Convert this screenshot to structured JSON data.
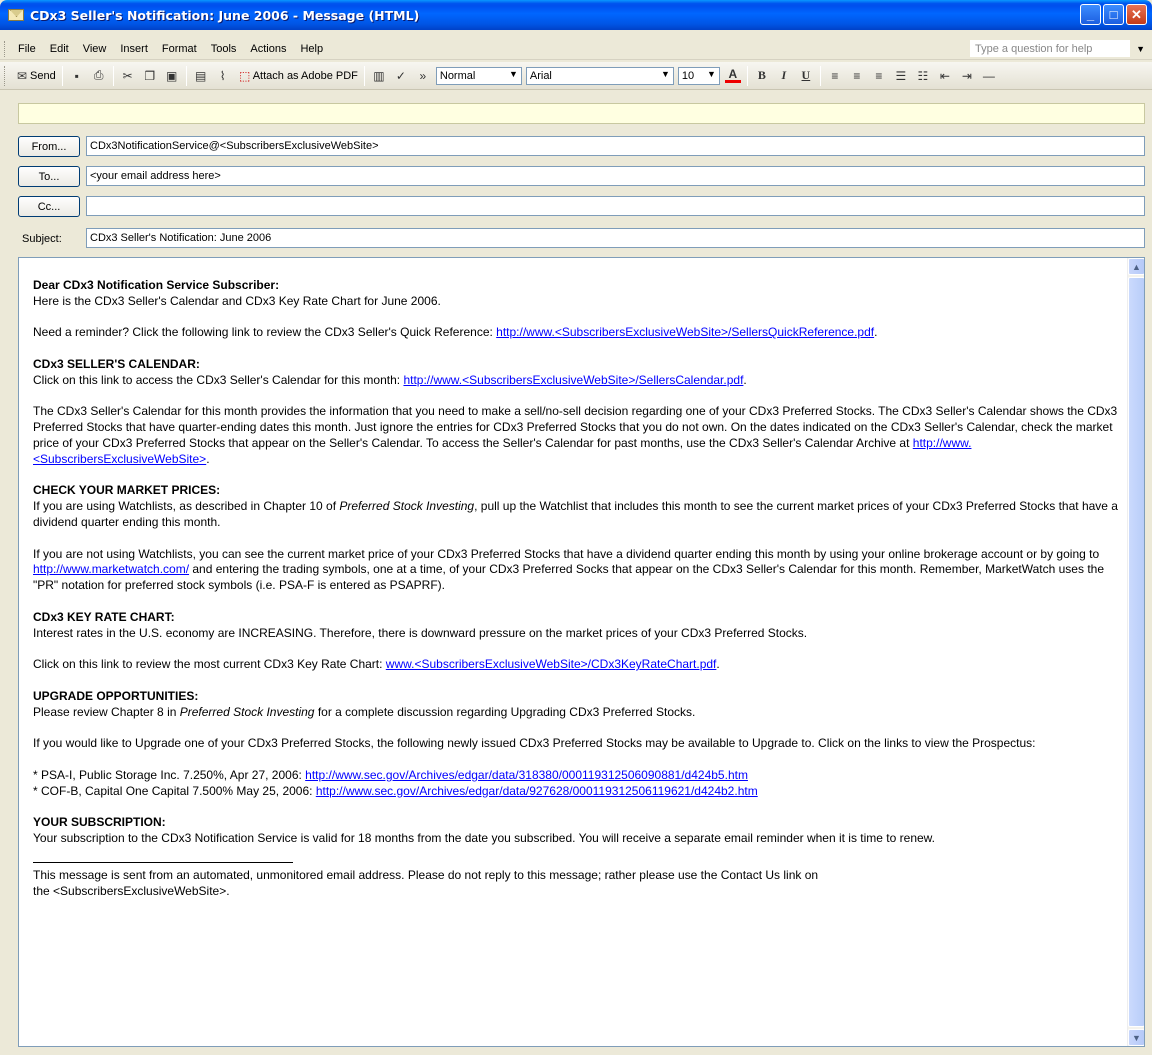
{
  "window": {
    "title": "CDx3 Seller's Notification: June 2006 - Message (HTML)",
    "controls": {
      "minimize": "_",
      "maximize": "□",
      "close": "✕"
    }
  },
  "menu": {
    "items": [
      "File",
      "Edit",
      "View",
      "Insert",
      "Format",
      "Tools",
      "Actions",
      "Help"
    ],
    "help_placeholder": "Type a question for help"
  },
  "toolbar": {
    "send_label": "Send",
    "attach_pdf_label": "Attach as Adobe PDF",
    "style_value": "Normal",
    "font_value": "Arial",
    "size_value": "10",
    "bold": "B",
    "italic": "I",
    "underline": "U",
    "font_color_glyph": "A"
  },
  "header": {
    "from_button": "From...",
    "from_value": "CDx3NotificationService@<SubscribersExclusiveWebSite>",
    "to_button": "To...",
    "to_value": "<your email address here>",
    "cc_button": "Cc...",
    "cc_value": "",
    "subject_label": "Subject:",
    "subject_value": "CDx3 Seller's Notification: June 2006"
  },
  "message": {
    "greeting": "Dear CDx3 Notification Service Subscriber:",
    "intro": "Here is the CDx3 Seller's Calendar and CDx3 Key Rate Chart for June 2006.",
    "reminder_text": "Need a reminder? Click the following link to review the CDx3 Seller's Quick Reference: ",
    "reminder_link": "http://www.<SubscribersExclusiveWebSite>/SellersQuickReference.pdf",
    "calendar_heading": "CDx3 SELLER'S CALENDAR:",
    "calendar_text": "Click on this link to access the CDx3 Seller's Calendar for this month:  ",
    "calendar_link": "http://www.<SubscribersExclusiveWebSite>/SellersCalendar.pdf",
    "calendar_desc": "The CDx3 Seller's Calendar for this month provides the information that you need to make a sell/no-sell decision regarding one of your CDx3 Preferred Stocks. The CDx3 Seller's Calendar shows the CDx3 Preferred Stocks that have quarter-ending dates this month.  Just ignore the entries for CDx3 Preferred Stocks that you do not own.  On the dates indicated on the CDx3 Seller's Calendar, check the market price of your CDx3 Preferred Stocks that appear on the Seller's Calendar.  To access the Seller's Calendar for past months, use the CDx3 Seller's Calendar Archive at ",
    "archive_link": "http://www.<SubscribersExclusiveWebSite>",
    "market_heading": "CHECK YOUR MARKET PRICES:",
    "market_text_1a": "If you are using Watchlists, as described in Chapter 10 of ",
    "book_title": "Preferred Stock Investing",
    "market_text_1b": ", pull up the Watchlist that includes this month to see the current market prices of your CDx3 Preferred Stocks that have a dividend quarter ending this month.",
    "market_text_2a": "If you are not using Watchlists, you can see the current market price of your CDx3 Preferred Stocks that have a dividend quarter ending this month by using your online brokerage account or by going to ",
    "marketwatch_link": "http://www.marketwatch.com/",
    "market_text_2b": " and entering the trading symbols, one at a time, of your CDx3 Preferred Socks that appear on the CDx3 Seller's Calendar for this month.  Remember, MarketWatch uses the \"PR\" notation for preferred stock symbols (i.e. PSA-F is entered as PSAPRF).",
    "keyrate_heading": "CDx3 KEY RATE CHART:",
    "keyrate_text": "Interest rates in the U.S. economy are INCREASING.  Therefore, there is downward pressure on the market prices of your CDx3 Preferred Stocks.",
    "keyrate_link_text": "Click on this link to review the most current CDx3 Key Rate Chart: ",
    "keyrate_link": "www.<SubscribersExclusiveWebSite>/CDx3KeyRateChart.pdf",
    "upgrade_heading": "UPGRADE OPPORTUNITIES:",
    "upgrade_text_a": "Please review Chapter 8 in ",
    "upgrade_text_b": " for a complete discussion regarding Upgrading CDx3 Preferred Stocks.",
    "upgrade_text_2": "If you would like to Upgrade one of your CDx3 Preferred Stocks, the following newly issued CDx3 Preferred Stocks may be available to Upgrade to.  Click on the links to view the Prospectus:",
    "stocks": [
      {
        "text": "* PSA-I, Public Storage Inc.   7.250%, Apr 27, 2006: ",
        "link": "http://www.sec.gov/Archives/edgar/data/318380/000119312506090881/d424b5.htm"
      },
      {
        "text": "* COF-B, Capital One Capital 7.500% May 25, 2006: ",
        "link": "http://www.sec.gov/Archives/edgar/data/927628/000119312506119621/d424b2.htm"
      }
    ],
    "subscription_heading": "YOUR SUBSCRIPTION:",
    "subscription_text": "Your subscription to the CDx3 Notification Service is valid for 18 months from the date you subscribed. You will receive a separate email reminder when it is time to renew.",
    "footer_line_1": "This message is sent from an automated, unmonitored email address. Please do not reply to this message; rather please use the Contact Us link on",
    "footer_line_2": "the <SubscribersExclusiveWebSite>."
  }
}
